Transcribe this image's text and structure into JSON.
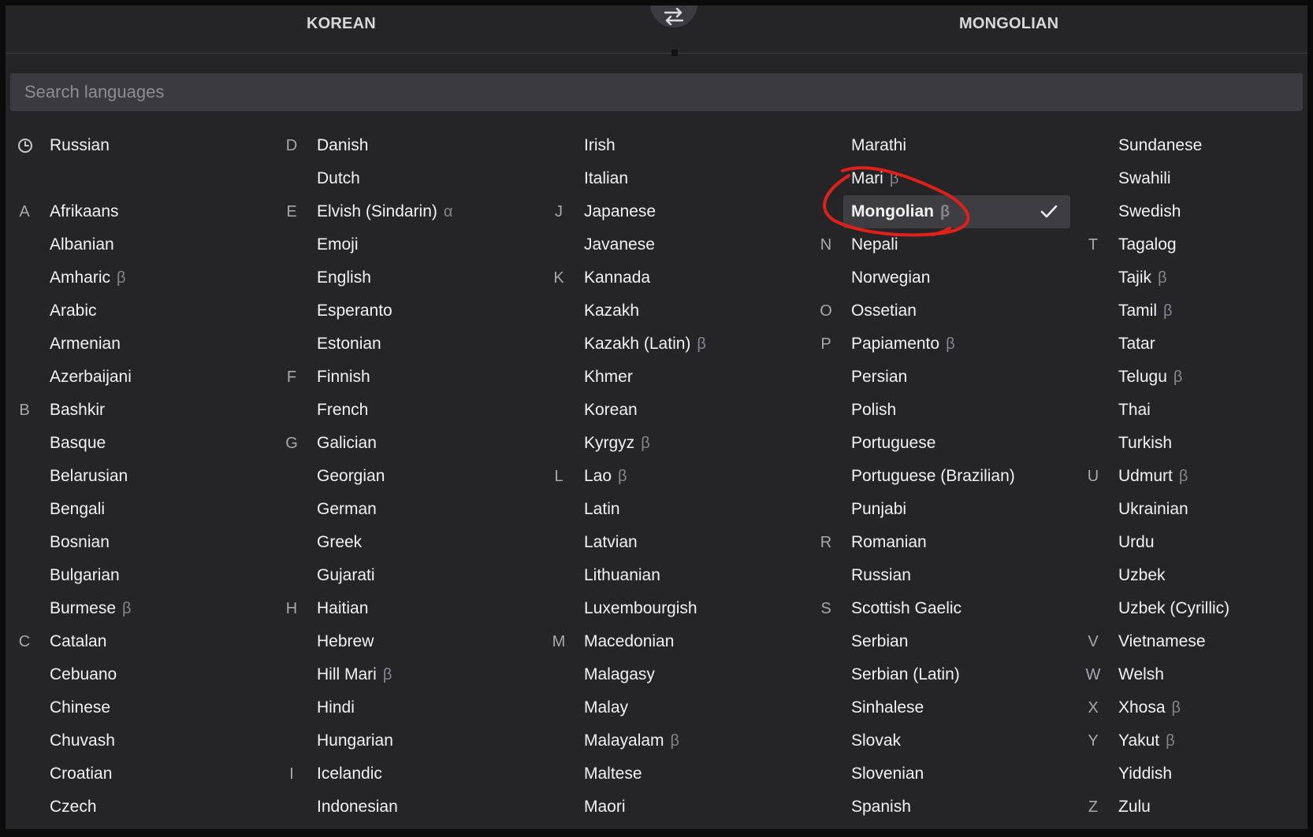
{
  "header": {
    "source_language": "KOREAN",
    "target_language": "MONGOLIAN",
    "swap_icon": "swap-arrows-icon"
  },
  "search": {
    "placeholder": "Search languages",
    "value": ""
  },
  "recent_icon": "clock-icon",
  "selected_language": "Mongolian",
  "annotation": {
    "color": "#e0201a",
    "shape": "hand-drawn circle around Mongolian"
  },
  "accent_colors": {
    "selected_bg": "#3d3d42",
    "annotation": "#e0201a"
  },
  "columns": [
    [
      {
        "letter": "",
        "name": "Russian",
        "tag": "",
        "recent": true
      },
      {
        "letter": "",
        "name": "",
        "tag": "",
        "spacer": true
      },
      {
        "letter": "A",
        "name": "Afrikaans",
        "tag": ""
      },
      {
        "letter": "",
        "name": "Albanian",
        "tag": ""
      },
      {
        "letter": "",
        "name": "Amharic",
        "tag": "β"
      },
      {
        "letter": "",
        "name": "Arabic",
        "tag": ""
      },
      {
        "letter": "",
        "name": "Armenian",
        "tag": ""
      },
      {
        "letter": "",
        "name": "Azerbaijani",
        "tag": ""
      },
      {
        "letter": "B",
        "name": "Bashkir",
        "tag": ""
      },
      {
        "letter": "",
        "name": "Basque",
        "tag": ""
      },
      {
        "letter": "",
        "name": "Belarusian",
        "tag": ""
      },
      {
        "letter": "",
        "name": "Bengali",
        "tag": ""
      },
      {
        "letter": "",
        "name": "Bosnian",
        "tag": ""
      },
      {
        "letter": "",
        "name": "Bulgarian",
        "tag": ""
      },
      {
        "letter": "",
        "name": "Burmese",
        "tag": "β"
      },
      {
        "letter": "C",
        "name": "Catalan",
        "tag": ""
      },
      {
        "letter": "",
        "name": "Cebuano",
        "tag": ""
      },
      {
        "letter": "",
        "name": "Chinese",
        "tag": ""
      },
      {
        "letter": "",
        "name": "Chuvash",
        "tag": ""
      },
      {
        "letter": "",
        "name": "Croatian",
        "tag": ""
      },
      {
        "letter": "",
        "name": "Czech",
        "tag": ""
      }
    ],
    [
      {
        "letter": "D",
        "name": "Danish",
        "tag": ""
      },
      {
        "letter": "",
        "name": "Dutch",
        "tag": ""
      },
      {
        "letter": "E",
        "name": "Elvish (Sindarin)",
        "tag": "α"
      },
      {
        "letter": "",
        "name": "Emoji",
        "tag": ""
      },
      {
        "letter": "",
        "name": "English",
        "tag": ""
      },
      {
        "letter": "",
        "name": "Esperanto",
        "tag": ""
      },
      {
        "letter": "",
        "name": "Estonian",
        "tag": ""
      },
      {
        "letter": "F",
        "name": "Finnish",
        "tag": ""
      },
      {
        "letter": "",
        "name": "French",
        "tag": ""
      },
      {
        "letter": "G",
        "name": "Galician",
        "tag": ""
      },
      {
        "letter": "",
        "name": "Georgian",
        "tag": ""
      },
      {
        "letter": "",
        "name": "German",
        "tag": ""
      },
      {
        "letter": "",
        "name": "Greek",
        "tag": ""
      },
      {
        "letter": "",
        "name": "Gujarati",
        "tag": ""
      },
      {
        "letter": "H",
        "name": "Haitian",
        "tag": ""
      },
      {
        "letter": "",
        "name": "Hebrew",
        "tag": ""
      },
      {
        "letter": "",
        "name": "Hill Mari",
        "tag": "β"
      },
      {
        "letter": "",
        "name": "Hindi",
        "tag": ""
      },
      {
        "letter": "",
        "name": "Hungarian",
        "tag": ""
      },
      {
        "letter": "I",
        "name": "Icelandic",
        "tag": ""
      },
      {
        "letter": "",
        "name": "Indonesian",
        "tag": ""
      }
    ],
    [
      {
        "letter": "",
        "name": "Irish",
        "tag": ""
      },
      {
        "letter": "",
        "name": "Italian",
        "tag": ""
      },
      {
        "letter": "J",
        "name": "Japanese",
        "tag": ""
      },
      {
        "letter": "",
        "name": "Javanese",
        "tag": ""
      },
      {
        "letter": "K",
        "name": "Kannada",
        "tag": ""
      },
      {
        "letter": "",
        "name": "Kazakh",
        "tag": ""
      },
      {
        "letter": "",
        "name": "Kazakh (Latin)",
        "tag": "β"
      },
      {
        "letter": "",
        "name": "Khmer",
        "tag": ""
      },
      {
        "letter": "",
        "name": "Korean",
        "tag": ""
      },
      {
        "letter": "",
        "name": "Kyrgyz",
        "tag": "β"
      },
      {
        "letter": "L",
        "name": "Lao",
        "tag": "β"
      },
      {
        "letter": "",
        "name": "Latin",
        "tag": ""
      },
      {
        "letter": "",
        "name": "Latvian",
        "tag": ""
      },
      {
        "letter": "",
        "name": "Lithuanian",
        "tag": ""
      },
      {
        "letter": "",
        "name": "Luxembourgish",
        "tag": ""
      },
      {
        "letter": "M",
        "name": "Macedonian",
        "tag": ""
      },
      {
        "letter": "",
        "name": "Malagasy",
        "tag": ""
      },
      {
        "letter": "",
        "name": "Malay",
        "tag": ""
      },
      {
        "letter": "",
        "name": "Malayalam",
        "tag": "β"
      },
      {
        "letter": "",
        "name": "Maltese",
        "tag": ""
      },
      {
        "letter": "",
        "name": "Maori",
        "tag": ""
      }
    ],
    [
      {
        "letter": "",
        "name": "Marathi",
        "tag": ""
      },
      {
        "letter": "",
        "name": "Mari",
        "tag": "β"
      },
      {
        "letter": "",
        "name": "Mongolian",
        "tag": "β",
        "selected": true
      },
      {
        "letter": "N",
        "name": "Nepali",
        "tag": ""
      },
      {
        "letter": "",
        "name": "Norwegian",
        "tag": ""
      },
      {
        "letter": "O",
        "name": "Ossetian",
        "tag": ""
      },
      {
        "letter": "P",
        "name": "Papiamento",
        "tag": "β"
      },
      {
        "letter": "",
        "name": "Persian",
        "tag": ""
      },
      {
        "letter": "",
        "name": "Polish",
        "tag": ""
      },
      {
        "letter": "",
        "name": "Portuguese",
        "tag": ""
      },
      {
        "letter": "",
        "name": "Portuguese (Brazilian)",
        "tag": ""
      },
      {
        "letter": "",
        "name": "Punjabi",
        "tag": ""
      },
      {
        "letter": "R",
        "name": "Romanian",
        "tag": ""
      },
      {
        "letter": "",
        "name": "Russian",
        "tag": ""
      },
      {
        "letter": "S",
        "name": "Scottish Gaelic",
        "tag": ""
      },
      {
        "letter": "",
        "name": "Serbian",
        "tag": ""
      },
      {
        "letter": "",
        "name": "Serbian (Latin)",
        "tag": ""
      },
      {
        "letter": "",
        "name": "Sinhalese",
        "tag": ""
      },
      {
        "letter": "",
        "name": "Slovak",
        "tag": ""
      },
      {
        "letter": "",
        "name": "Slovenian",
        "tag": ""
      },
      {
        "letter": "",
        "name": "Spanish",
        "tag": ""
      }
    ],
    [
      {
        "letter": "",
        "name": "Sundanese",
        "tag": ""
      },
      {
        "letter": "",
        "name": "Swahili",
        "tag": ""
      },
      {
        "letter": "",
        "name": "Swedish",
        "tag": ""
      },
      {
        "letter": "T",
        "name": "Tagalog",
        "tag": ""
      },
      {
        "letter": "",
        "name": "Tajik",
        "tag": "β"
      },
      {
        "letter": "",
        "name": "Tamil",
        "tag": "β"
      },
      {
        "letter": "",
        "name": "Tatar",
        "tag": ""
      },
      {
        "letter": "",
        "name": "Telugu",
        "tag": "β"
      },
      {
        "letter": "",
        "name": "Thai",
        "tag": ""
      },
      {
        "letter": "",
        "name": "Turkish",
        "tag": ""
      },
      {
        "letter": "U",
        "name": "Udmurt",
        "tag": "β"
      },
      {
        "letter": "",
        "name": "Ukrainian",
        "tag": ""
      },
      {
        "letter": "",
        "name": "Urdu",
        "tag": ""
      },
      {
        "letter": "",
        "name": "Uzbek",
        "tag": ""
      },
      {
        "letter": "",
        "name": "Uzbek (Cyrillic)",
        "tag": ""
      },
      {
        "letter": "V",
        "name": "Vietnamese",
        "tag": ""
      },
      {
        "letter": "W",
        "name": "Welsh",
        "tag": ""
      },
      {
        "letter": "X",
        "name": "Xhosa",
        "tag": "β"
      },
      {
        "letter": "Y",
        "name": "Yakut",
        "tag": "β"
      },
      {
        "letter": "",
        "name": "Yiddish",
        "tag": ""
      },
      {
        "letter": "Z",
        "name": "Zulu",
        "tag": ""
      }
    ]
  ]
}
